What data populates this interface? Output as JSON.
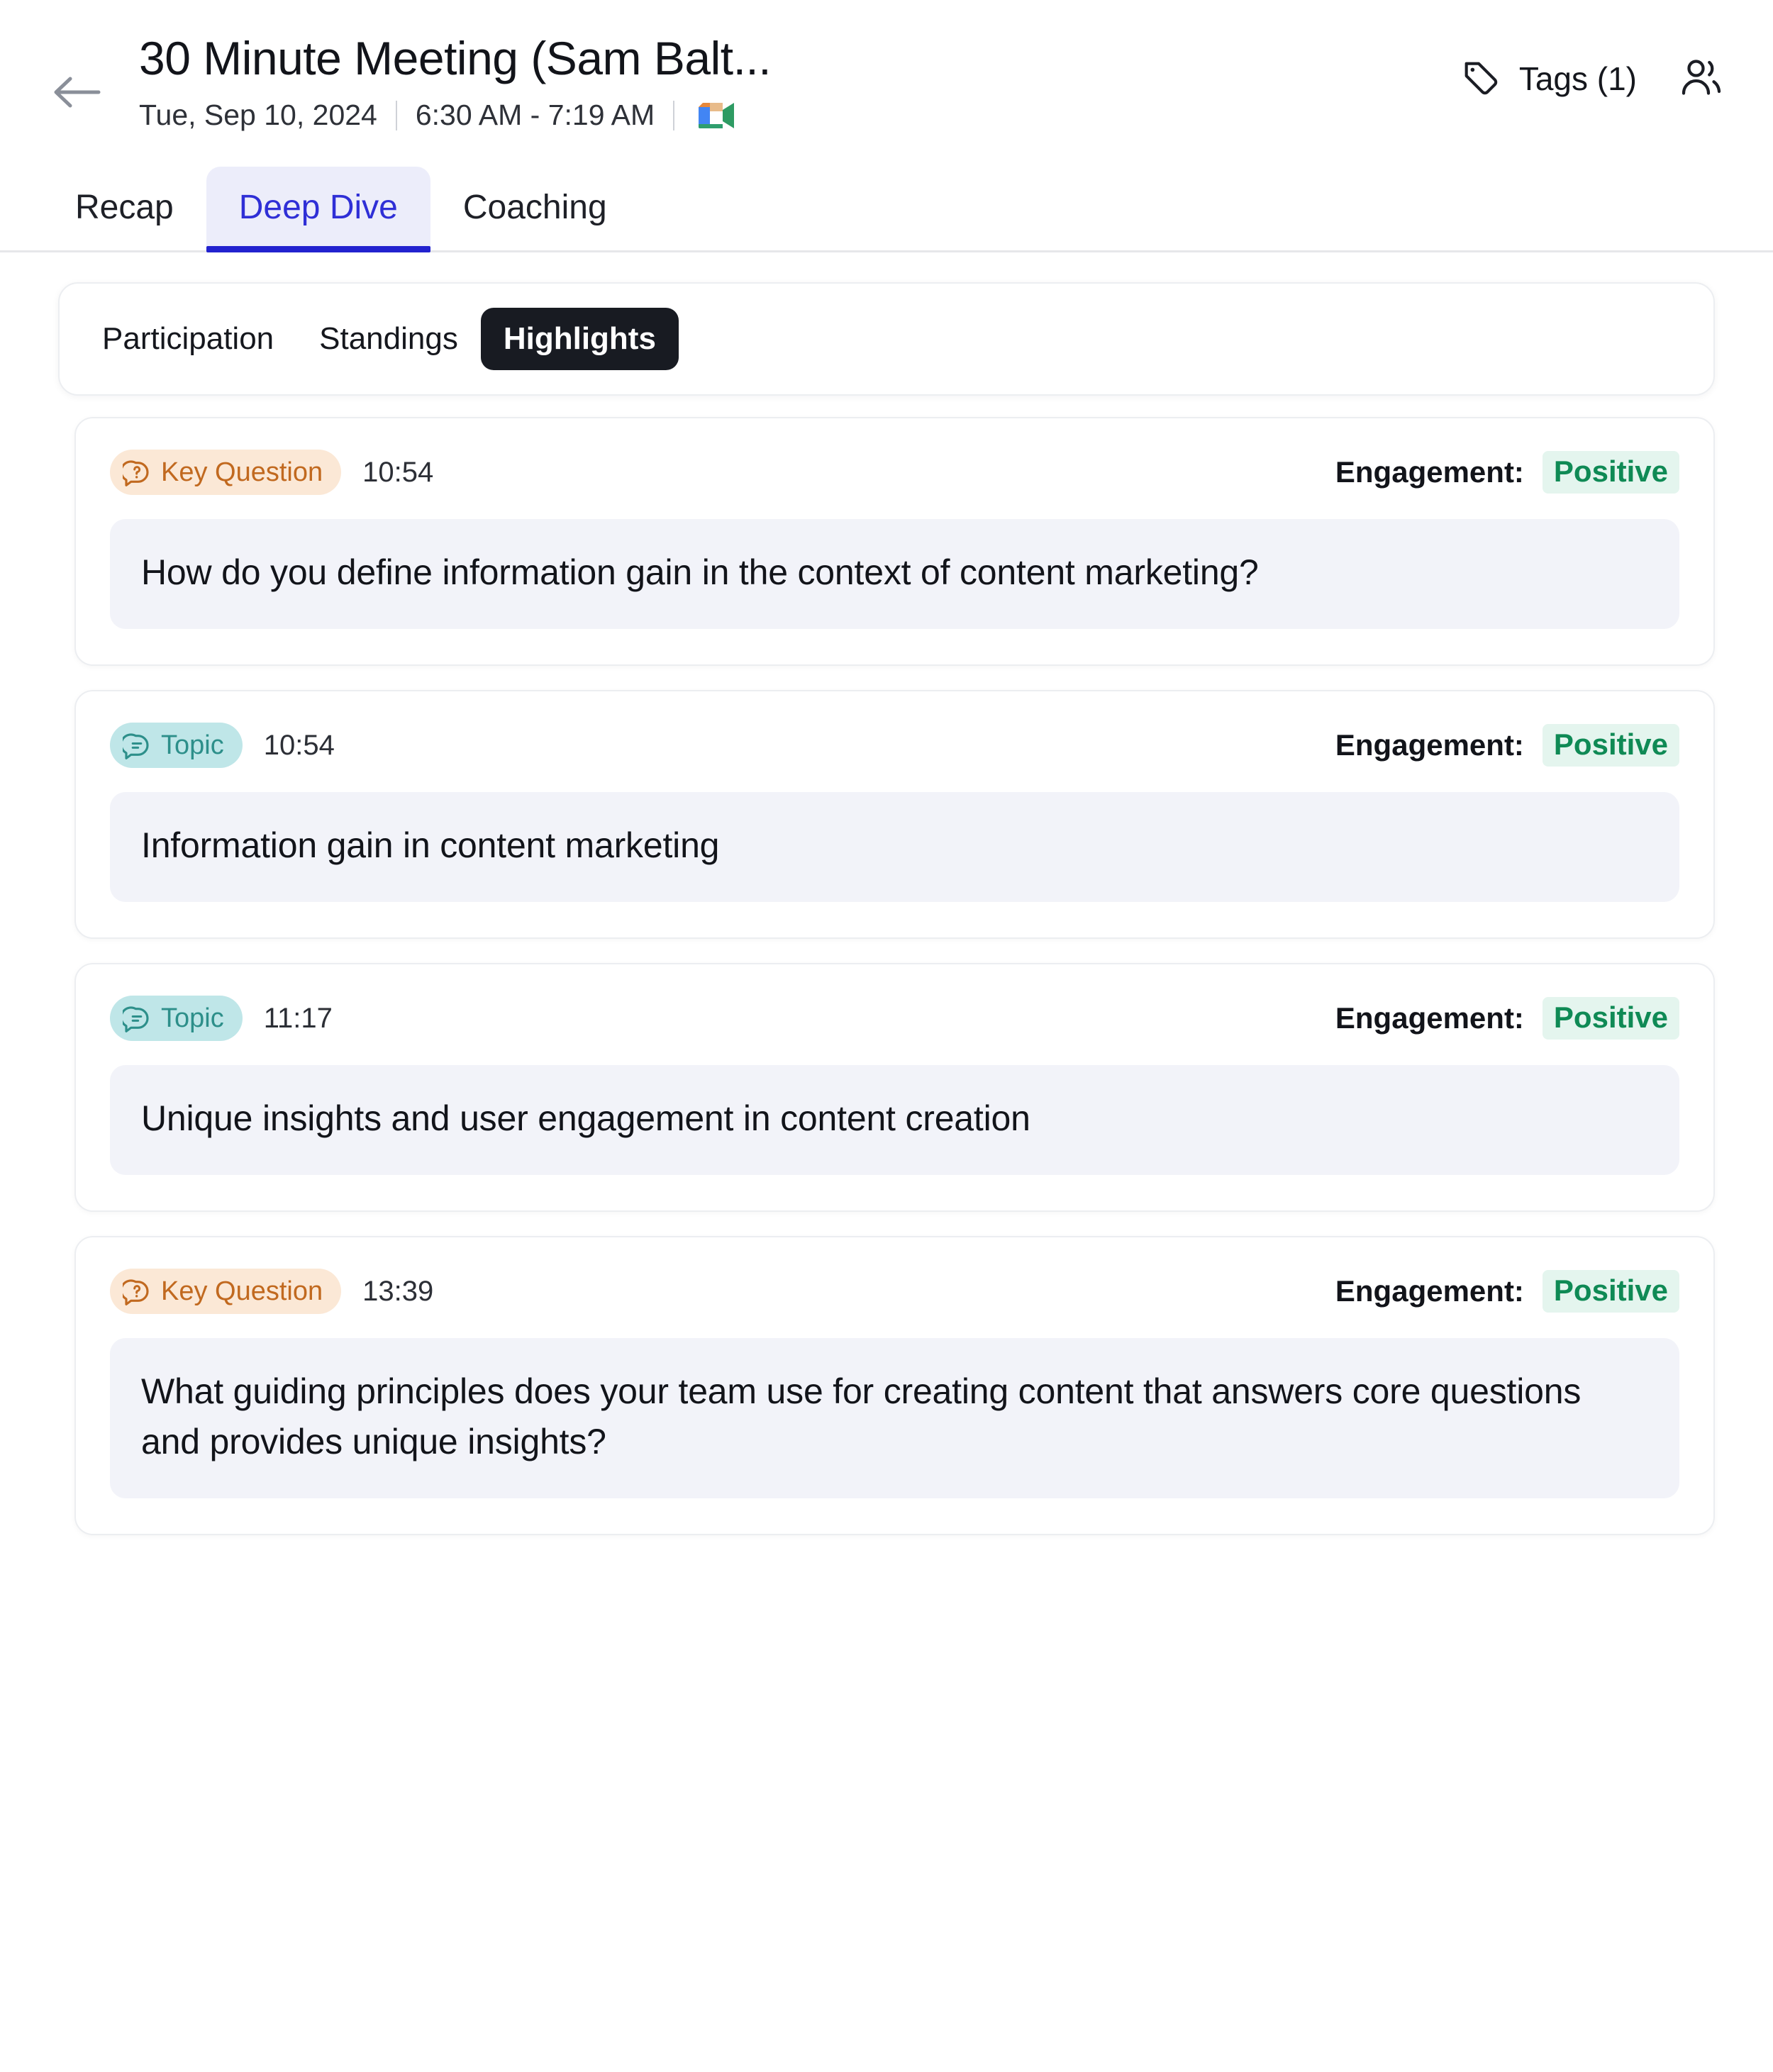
{
  "header": {
    "back_icon": "arrow-left-icon",
    "title": "30 Minute Meeting (Sam Balt...",
    "date": "Tue, Sep 10, 2024",
    "time_range": "6:30 AM - 7:19 AM",
    "meeting_platform_icon": "google-meet-video-icon",
    "tags_icon": "tag-icon",
    "tags_label": "Tags (1)",
    "people_icon": "people-icon"
  },
  "tabs": [
    {
      "label": "Recap",
      "active": false
    },
    {
      "label": "Deep Dive",
      "active": true
    },
    {
      "label": "Coaching",
      "active": false
    }
  ],
  "subtabs": [
    {
      "label": "Participation",
      "active": false
    },
    {
      "label": "Standings",
      "active": false
    },
    {
      "label": "Highlights",
      "active": true
    }
  ],
  "engagement_label": "Engagement:",
  "highlights": [
    {
      "badge": "Key Question",
      "badge_type": "key",
      "badge_icon": "question-bubble-icon",
      "time": "10:54",
      "engagement_label": "Engagement:",
      "engagement_value": "Positive",
      "text": "How do you define information gain in the context of content marketing?"
    },
    {
      "badge": "Topic",
      "badge_type": "topic",
      "badge_icon": "chat-bubble-icon",
      "time": "10:54",
      "engagement_label": "Engagement:",
      "engagement_value": "Positive",
      "text": "Information gain in content marketing"
    },
    {
      "badge": "Topic",
      "badge_type": "topic",
      "badge_icon": "chat-bubble-icon",
      "time": "11:17",
      "engagement_label": "Engagement:",
      "engagement_value": "Positive",
      "text": "Unique insights and user engagement in content creation"
    },
    {
      "badge": "Key Question",
      "badge_type": "key",
      "badge_icon": "question-bubble-icon",
      "time": "13:39",
      "engagement_label": "Engagement:",
      "engagement_value": "Positive",
      "text": "What guiding principles does your team use for creating content that answers core questions and provides unique insights?"
    }
  ],
  "colors": {
    "accent_blue": "#2222cf",
    "active_tab_bg": "#ecedfa",
    "key_badge_bg": "#fbe8d6",
    "key_badge_fg": "#c1691f",
    "topic_badge_bg": "#bfe6e8",
    "topic_badge_fg": "#2d8f8a",
    "positive_fg": "#0f8a55",
    "positive_bg": "#e4f5ee",
    "body_bg": "#f2f3f9",
    "subtab_active_bg": "#181b22"
  }
}
